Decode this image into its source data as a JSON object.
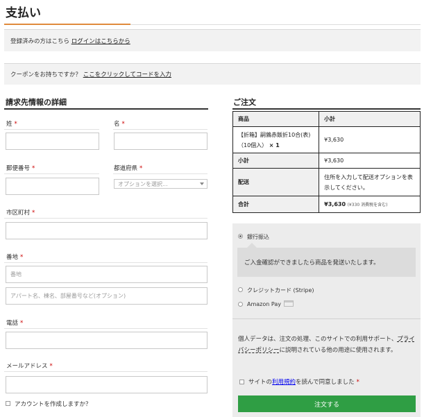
{
  "page": {
    "title": "支払い"
  },
  "notices": {
    "login_text": "登録済みの方はこちら",
    "login_link": "ログインはこちらから",
    "coupon_text": "クーポンをお持ちですか？",
    "coupon_link": "ここをクリックしてコードを入力"
  },
  "billing": {
    "heading": "請求先情報の詳細",
    "last_name_label": "姓",
    "first_name_label": "名",
    "postcode_label": "郵便番号",
    "prefecture_label": "都道府県",
    "prefecture_placeholder": "オプションを選択...",
    "city_label": "市区町村",
    "address_label": "番地",
    "address1_placeholder": "番地",
    "address2_placeholder": "アパート名、棟名、部屋番号など(オプション)",
    "phone_label": "電話",
    "email_label": "メールアドレス",
    "required_mark": "*",
    "create_account_label": "アカウントを作成しますか？"
  },
  "order": {
    "heading": "ご注文",
    "col_product": "商品",
    "col_subtotal": "小計",
    "item_name": "【折箱】嗣鶉赤飯折10合(表)（10個入）",
    "item_qty": "× 1",
    "item_price": "¥3,630",
    "subtotal_label": "小計",
    "subtotal_value": "¥3,630",
    "shipping_label": "配送",
    "shipping_value": "住所を入力して配送オプションを表示してください。",
    "total_label": "合計",
    "total_value": "¥3,630",
    "total_tax_note": "(¥330 消費税を含む)"
  },
  "payment": {
    "methods": [
      {
        "label": "銀行振込",
        "selected": true
      },
      {
        "label": "クレジットカード (Stripe)",
        "selected": false
      },
      {
        "label": "Amazon Pay",
        "selected": false
      }
    ],
    "bank_description": "ご入金確認ができましたら商品を発送いたします。",
    "privacy_text_before": "個人データは、注文の処理、このサイトでの利用サポート、",
    "privacy_link": "プライバシーポリシー",
    "privacy_text_after": "に説明されている他の用途に使用されます。",
    "terms_before": "サイトの",
    "terms_link": "利用規約",
    "terms_after": "を読んで同意しました",
    "required_mark": "*",
    "place_order_label": "注文する"
  },
  "colors": {
    "accent": "#e08a3c",
    "button": "#2f9e44",
    "required": "#cc0000"
  }
}
